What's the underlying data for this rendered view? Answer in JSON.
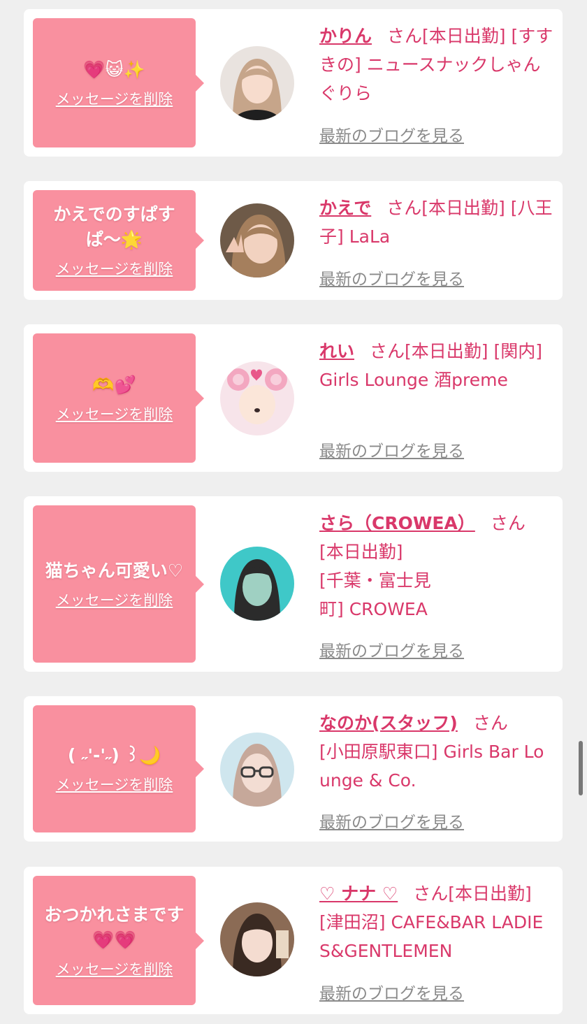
{
  "delete_label": "メッセージを削除",
  "blog_label": "最新のブログを見る",
  "san_label": "さん",
  "colors": {
    "background": "#efefef",
    "card": "#ffffff",
    "bubble": "#f9909f",
    "accent": "#d9386a",
    "link_gray": "#8a8a8a"
  },
  "entries": [
    {
      "message": "💗😺✨",
      "name": "かりん",
      "status": "[本日出勤]",
      "location_shop": "[すすきの] ニュースナックしゃんぐりら",
      "avatar_icon": "avatar-photo-icon"
    },
    {
      "message": "かえでのすぱすぱ〜🌟",
      "name": "かえで",
      "status": "[本日出勤]",
      "location_shop": "[八王子] LaLa",
      "avatar_icon": "avatar-photo-icon"
    },
    {
      "message": "🫶💕",
      "name": "れい",
      "status": "[本日出勤]",
      "location_shop": "[関内] Girls Lounge 酒preme",
      "avatar_icon": "avatar-photo-icon"
    },
    {
      "message": "猫ちゃん可愛い♡",
      "name": "さら（CROWEA）",
      "status": "[本日出勤]",
      "location_shop": "[千葉・富士見町] CROWEA",
      "avatar_icon": "avatar-photo-icon"
    },
    {
      "message": "( ˶'-'˶) ꒱🌙",
      "name": "なのか(スタッフ)",
      "status": "",
      "location_shop": "[小田原駅東口] Girls Bar Lounge & Co.",
      "avatar_icon": "avatar-photo-icon"
    },
    {
      "message": "おつかれさまです💗💗",
      "name": "♡ ナナ ♡",
      "status": "[本日出勤]",
      "location_shop": "[津田沼] CAFE&BAR LADIES&GENTLEMEN",
      "avatar_icon": "avatar-photo-icon"
    }
  ]
}
